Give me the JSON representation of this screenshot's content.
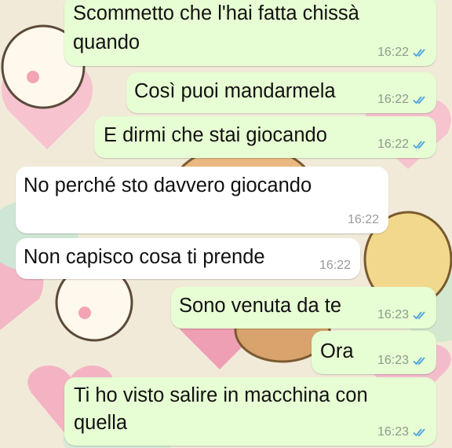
{
  "theme": {
    "outgoing_bubble": "#e7fdd3",
    "incoming_bubble": "#ffffff",
    "read_tick_color": "#4fa3e0",
    "meta_color": "#8e9a8e"
  },
  "messages": [
    {
      "direction": "outgoing",
      "lines": [
        "Scommetto che l'hai fatta chissà",
        "quando"
      ],
      "time": "16:22",
      "status": "read-double-tick-icon"
    },
    {
      "direction": "outgoing",
      "lines": [
        "Così puoi mandarmela"
      ],
      "time": "16:22",
      "status": "read-double-tick-icon"
    },
    {
      "direction": "outgoing",
      "lines": [
        "E dirmi che stai giocando"
      ],
      "time": "16:22",
      "status": "read-double-tick-icon"
    },
    {
      "direction": "incoming",
      "lines": [
        "No perché sto davvero giocando"
      ],
      "time": "16:22"
    },
    {
      "direction": "incoming",
      "lines": [
        "Non capisco cosa ti prende"
      ],
      "time": "16:22"
    },
    {
      "direction": "outgoing",
      "lines": [
        "Sono venuta da te"
      ],
      "time": "16:23",
      "status": "read-double-tick-icon"
    },
    {
      "direction": "outgoing",
      "lines": [
        "Ora"
      ],
      "time": "16:23",
      "status": "read-double-tick-icon"
    },
    {
      "direction": "outgoing",
      "lines": [
        "Ti ho visto salire in macchina con",
        "quella"
      ],
      "time": "16:23",
      "status": "read-double-tick-icon"
    }
  ]
}
